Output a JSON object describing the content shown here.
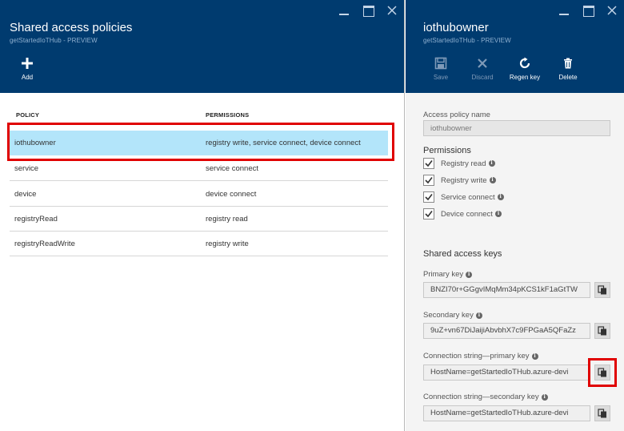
{
  "left_blade": {
    "title": "Shared access policies",
    "subtitle": "getStartedIoTHub - PREVIEW",
    "add_label": "Add",
    "columns": [
      "POLICY",
      "PERMISSIONS"
    ],
    "rows": [
      {
        "policy": "iothubowner",
        "permissions": "registry write, service connect, device connect"
      },
      {
        "policy": "service",
        "permissions": "service connect"
      },
      {
        "policy": "device",
        "permissions": "device connect"
      },
      {
        "policy": "registryRead",
        "permissions": "registry read"
      },
      {
        "policy": "registryReadWrite",
        "permissions": "registry write"
      }
    ]
  },
  "right_blade": {
    "title": "iothubowner",
    "subtitle": "getStartedIoTHub - PREVIEW",
    "commands": {
      "save": "Save",
      "discard": "Discard",
      "regen": "Regen key",
      "delete": "Delete"
    },
    "access_policy_name_label": "Access policy name",
    "access_policy_name_value": "iothubowner",
    "permissions_label": "Permissions",
    "permissions": [
      {
        "label": "Registry read",
        "checked": true
      },
      {
        "label": "Registry write",
        "checked": true
      },
      {
        "label": "Service connect",
        "checked": true
      },
      {
        "label": "Device connect",
        "checked": true
      }
    ],
    "keys_label": "Shared access keys",
    "primary_key_label": "Primary key",
    "primary_key_value": "BNZI70r+GGgvIMqMm34pKCS1kF1aGtTW",
    "secondary_key_label": "Secondary key",
    "secondary_key_value": "9uZ+vn67DiJaijiAbvbhX7c9FPGaA5QFaZz",
    "conn_primary_label": "Connection string—primary key",
    "conn_primary_value": "HostName=getStartedIoTHub.azure-devi",
    "conn_secondary_label": "Connection string—secondary key",
    "conn_secondary_value": "HostName=getStartedIoTHub.azure-devi"
  },
  "colors": {
    "header_bg": "#003b6f",
    "selected_row": "#b3e5fa",
    "highlight": "#e00000"
  }
}
